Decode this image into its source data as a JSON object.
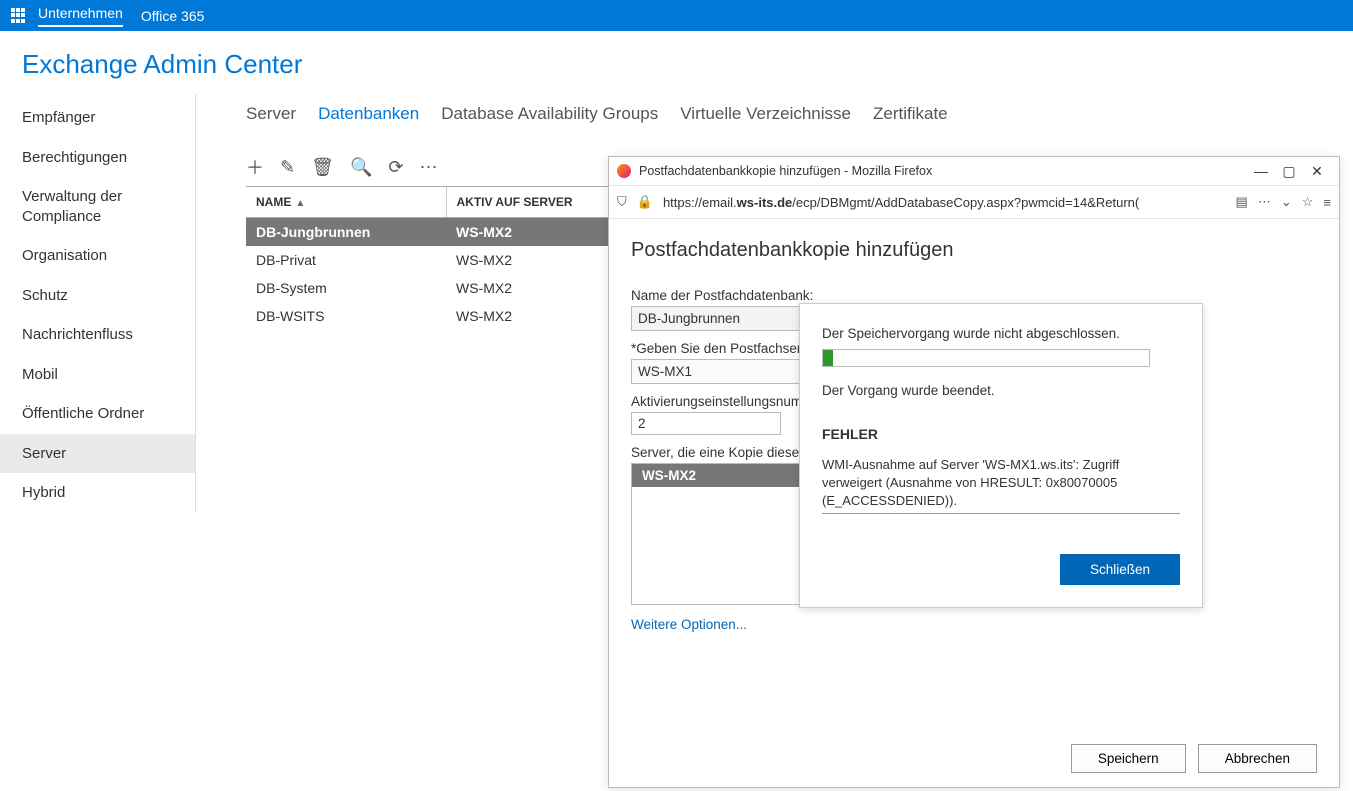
{
  "topbar": {
    "link_company": "Unternehmen",
    "link_o365": "Office 365"
  },
  "page_title": "Exchange Admin Center",
  "sidebar": {
    "items": [
      "Empfänger",
      "Berechtigungen",
      "Verwaltung der Compliance",
      "Organisation",
      "Schutz",
      "Nachrichtenfluss",
      "Mobil",
      "Öffentliche Ordner",
      "Server",
      "Hybrid"
    ],
    "selected_index": 8
  },
  "subnav": {
    "tabs": [
      "Server",
      "Datenbanken",
      "Database Availability Groups",
      "Virtuelle Verzeichnisse",
      "Zertifikate"
    ],
    "active_index": 1
  },
  "table": {
    "col_name": "NAME",
    "col_server": "AKTIV AUF SERVER",
    "rows": [
      {
        "name": "DB-Jungbrunnen",
        "server": "WS-MX2",
        "selected": true
      },
      {
        "name": "DB-Privat",
        "server": "WS-MX2",
        "selected": false
      },
      {
        "name": "DB-System",
        "server": "WS-MX2",
        "selected": false
      },
      {
        "name": "DB-WSITS",
        "server": "WS-MX2",
        "selected": false
      }
    ]
  },
  "ffwin": {
    "title": "Postfachdatenbankkopie hinzufügen - Mozilla Firefox",
    "url_prefix": "https://email.",
    "url_host": "ws-its.de",
    "url_rest": "/ecp/DBMgmt/AddDatabaseCopy.aspx?pwmcid=14&Return(",
    "heading": "Postfachdatenbankkopie hinzufügen",
    "lbl_dbname": "Name der Postfachdatenbank:",
    "val_dbname": "DB-Jungbrunnen",
    "lbl_server": "*Geben Sie den Postfachserv",
    "val_server": "WS-MX1",
    "lbl_actnum": "Aktivierungseinstellungsnum",
    "val_actnum": "2",
    "lbl_copies": "Server, die eine Kopie dieser",
    "copy_server": "WS-MX2",
    "more_options": "Weitere Optionen...",
    "btn_save": "Speichern",
    "btn_cancel": "Abbrechen"
  },
  "error": {
    "line1": "Der Speichervorgang wurde nicht abgeschlossen.",
    "line2": "Der Vorgang wurde beendet.",
    "header": "FEHLER",
    "detail": "WMI-Ausnahme auf Server 'WS-MX1.ws.its': Zugriff verweigert (Ausnahme von HRESULT: 0x80070005 (E_ACCESSDENIED)).",
    "close": "Schließen"
  }
}
